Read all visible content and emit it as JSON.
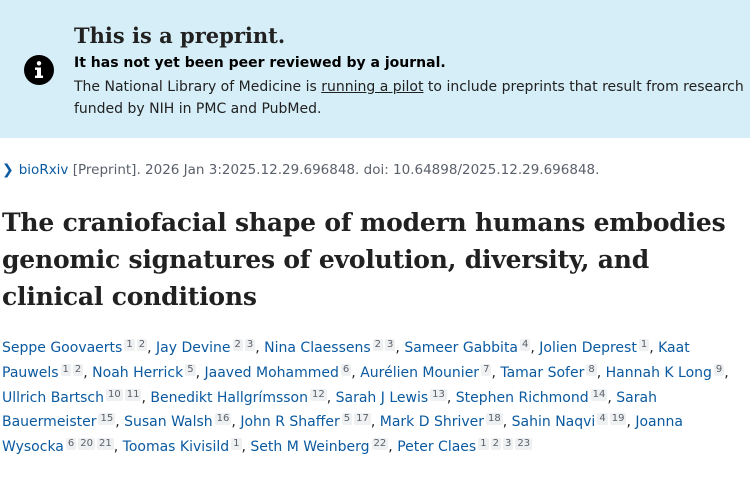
{
  "banner": {
    "title": "This is a preprint.",
    "subtitle": "It has not yet been peer reviewed by a journal.",
    "text_before": "The National Library of Medicine is ",
    "link": "running a pilot",
    "text_after": " to include preprints that result from research funded by NIH in PMC and PubMed.",
    "icon": "info-icon",
    "background_color": "#d6eef8"
  },
  "citation": {
    "source_link": "bioRxiv",
    "details": " [Preprint]. 2026 Jan 3:2025.12.29.696848. doi: 10.64898/2025.12.29.696848."
  },
  "article": {
    "title": "The craniofacial shape of modern humans embodies genomic signatures of evolution, diversity, and clinical conditions"
  },
  "authors": [
    {
      "name": "Seppe Goovaerts",
      "affs": [
        "1",
        "2"
      ]
    },
    {
      "name": "Jay Devine",
      "affs": [
        "2",
        "3"
      ]
    },
    {
      "name": "Nina Claessens",
      "affs": [
        "2",
        "3"
      ]
    },
    {
      "name": "Sameer Gabbita",
      "affs": [
        "4"
      ]
    },
    {
      "name": "Jolien Deprest",
      "affs": [
        "1"
      ]
    },
    {
      "name": "Kaat Pauwels",
      "affs": [
        "1",
        "2"
      ]
    },
    {
      "name": "Noah Herrick",
      "affs": [
        "5"
      ]
    },
    {
      "name": "Jaaved Mohammed",
      "affs": [
        "6"
      ]
    },
    {
      "name": "Aurélien Mounier",
      "affs": [
        "7"
      ]
    },
    {
      "name": "Tamar Sofer",
      "affs": [
        "8"
      ]
    },
    {
      "name": "Hannah K Long",
      "affs": [
        "9"
      ]
    },
    {
      "name": "Ullrich Bartsch",
      "affs": [
        "10",
        "11"
      ]
    },
    {
      "name": "Benedikt Hallgrímsson",
      "affs": [
        "12"
      ]
    },
    {
      "name": "Sarah J Lewis",
      "affs": [
        "13"
      ]
    },
    {
      "name": "Stephen Richmond",
      "affs": [
        "14"
      ]
    },
    {
      "name": "Sarah Bauermeister",
      "affs": [
        "15"
      ]
    },
    {
      "name": "Susan Walsh",
      "affs": [
        "16"
      ]
    },
    {
      "name": "John R Shaffer",
      "affs": [
        "5",
        "17"
      ]
    },
    {
      "name": "Mark D Shriver",
      "affs": [
        "18"
      ]
    },
    {
      "name": "Sahin Naqvi",
      "affs": [
        "4",
        "19"
      ]
    },
    {
      "name": "Joanna Wysocka",
      "affs": [
        "6",
        "20",
        "21"
      ]
    },
    {
      "name": "Toomas Kivisild",
      "affs": [
        "1"
      ]
    },
    {
      "name": "Seth M Weinberg",
      "affs": [
        "22"
      ]
    },
    {
      "name": "Peter Claes",
      "affs": [
        "1",
        "2",
        "3",
        "23"
      ]
    }
  ],
  "colors": {
    "link": "#0b5aa0",
    "text": "#212121",
    "muted": "#5b616b"
  }
}
